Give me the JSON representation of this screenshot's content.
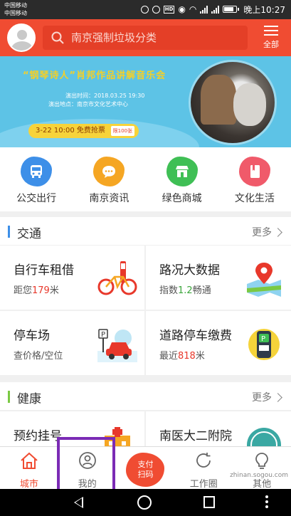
{
  "status": {
    "carrier1": "中国移动",
    "carrier2": "中国移动",
    "network": "4G",
    "network2": "2G",
    "hd": "HD",
    "time": "晚上10:27"
  },
  "header": {
    "search_placeholder": "南京强制垃圾分类",
    "menu_label": "全部"
  },
  "banner": {
    "title": "“钢琴诗人”肖邦作品讲解音乐会",
    "line1": "演出时间：2018.03.25 19:30",
    "line2": "演出地点：南京市文化艺术中心",
    "ticket": "3-22 10:00 免费抢票",
    "ticket_tag": "限100张"
  },
  "quicknav": [
    {
      "label": "公交出行",
      "icon": "bus-icon",
      "color": "#3d8fe8"
    },
    {
      "label": "南京资讯",
      "icon": "chat-icon",
      "color": "#f5a623"
    },
    {
      "label": "绿色商城",
      "icon": "shop-icon",
      "color": "#3fbf55"
    },
    {
      "label": "文化生活",
      "icon": "book-icon",
      "color": "#f05a6a"
    }
  ],
  "traffic": {
    "title": "交通",
    "more": "更多",
    "accent": "#3d8fe8",
    "cards": [
      {
        "title": "自行车租借",
        "sub_pre": "距您",
        "sub_val": "179",
        "sub_post": "米"
      },
      {
        "title": "路况大数据",
        "sub_pre": "指数",
        "sub_val": "1.2",
        "sub_post": "畅通"
      },
      {
        "title": "停车场",
        "sub_pre": "查价格/空位",
        "sub_val": "",
        "sub_post": ""
      },
      {
        "title": "道路停车缴费",
        "sub_pre": "最近",
        "sub_val": "818",
        "sub_post": "米"
      }
    ]
  },
  "health": {
    "title": "健康",
    "more": "更多",
    "accent": "#7ac943",
    "cards": [
      {
        "title": "预约挂号"
      },
      {
        "title": "南医大二附院"
      }
    ]
  },
  "tabbar": {
    "tab1": "城市",
    "tab2": "我的",
    "pay_top": "支付",
    "pay_bottom": "扫码",
    "tab4": "工作圈",
    "tab5": "其他"
  },
  "watermark": "zhinan.sogou.com"
}
